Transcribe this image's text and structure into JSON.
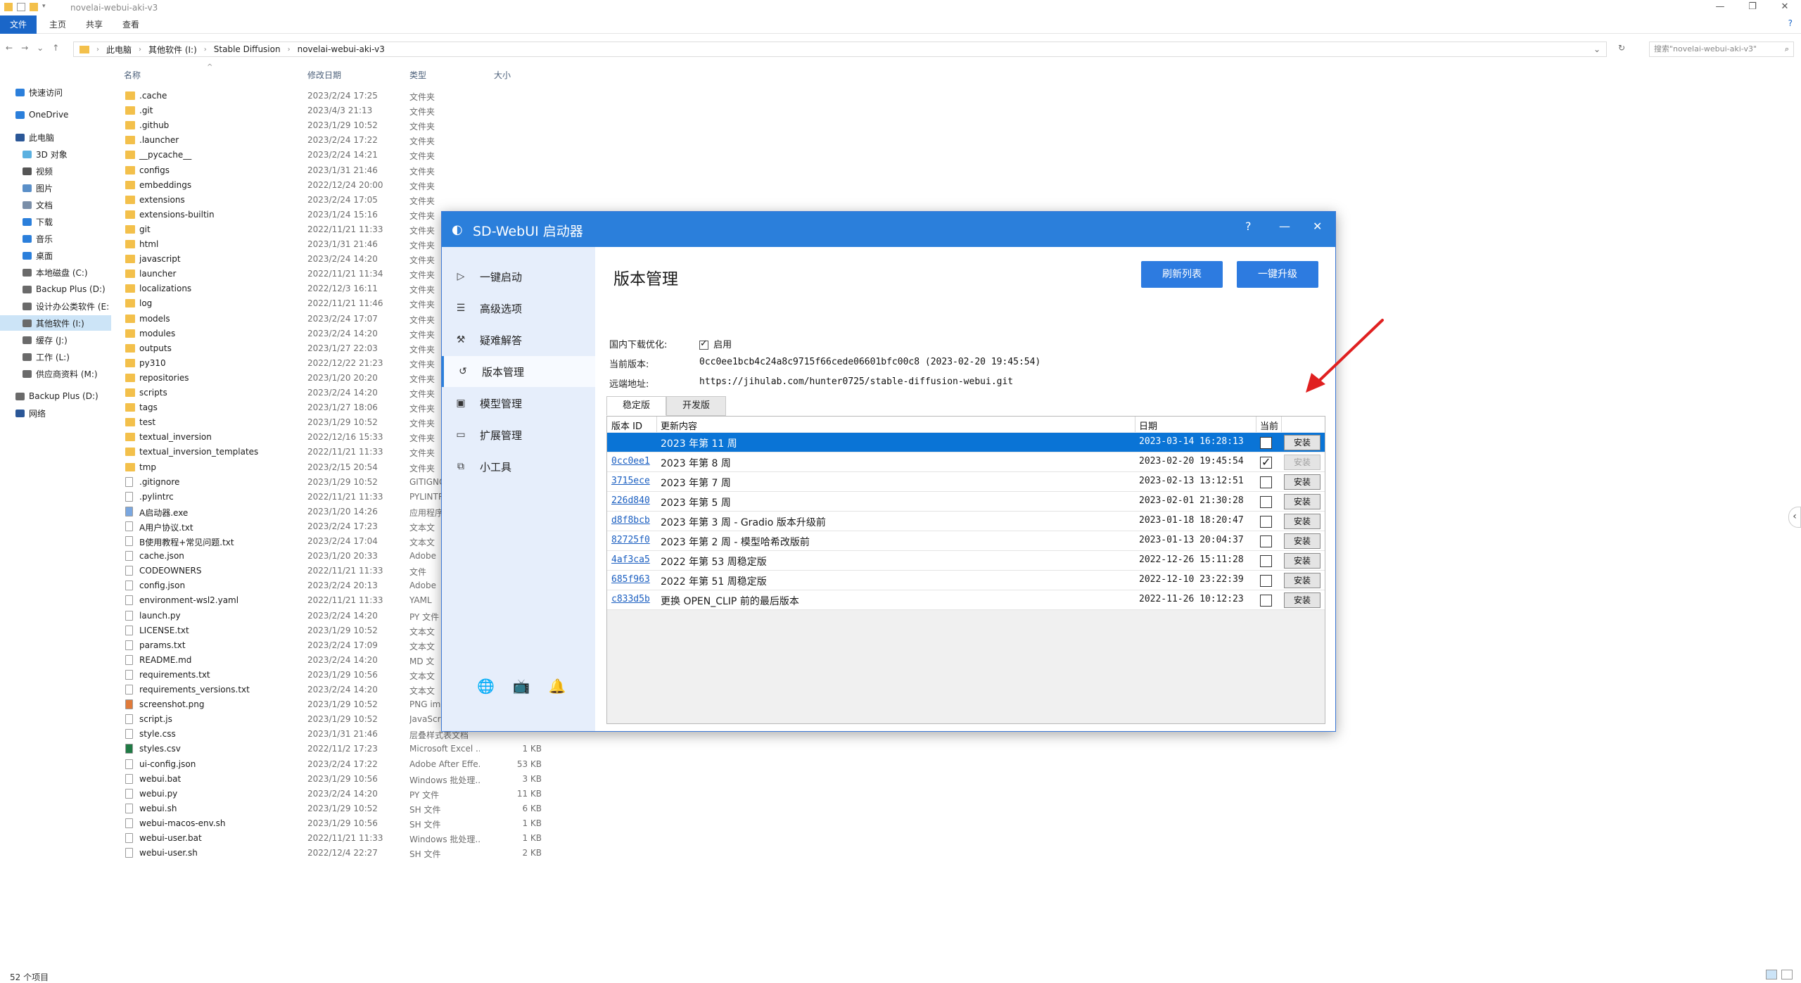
{
  "explorer": {
    "window_title": "novelai-webui-aki-v3",
    "ribbon_tabs": [
      "文件",
      "主页",
      "共享",
      "查看"
    ],
    "path": [
      "此电脑",
      "其他软件 (I:)",
      "Stable Diffusion",
      "novelai-webui-aki-v3"
    ],
    "search_placeholder": "搜索\"novelai-webui-aki-v3\"",
    "columns": {
      "name": "名称",
      "date": "修改日期",
      "type": "类型",
      "size": "大小"
    },
    "nav": [
      {
        "label": "快速访问",
        "icon": "star-icon",
        "color": "#2b7fdb"
      },
      {
        "label": "OneDrive",
        "icon": "cloud-icon",
        "color": "#2b7fdb"
      },
      {
        "label": "此电脑",
        "icon": "pc-icon",
        "color": "#2b5797"
      },
      {
        "label": "3D 对象",
        "icon": "cube-icon",
        "color": "#5ab0e0"
      },
      {
        "label": "视频",
        "icon": "video-icon",
        "color": "#555555"
      },
      {
        "label": "图片",
        "icon": "picture-icon",
        "color": "#5a8fc8"
      },
      {
        "label": "文档",
        "icon": "document-icon",
        "color": "#7a8ea8"
      },
      {
        "label": "下载",
        "icon": "download-icon",
        "color": "#2b7fdb"
      },
      {
        "label": "音乐",
        "icon": "music-icon",
        "color": "#2b7fdb"
      },
      {
        "label": "桌面",
        "icon": "desktop-icon",
        "color": "#2b7fdb"
      },
      {
        "label": "本地磁盘 (C:)",
        "icon": "drive-icon",
        "color": "#6a6a6a"
      },
      {
        "label": "Backup Plus (D:)",
        "icon": "drive-icon",
        "color": "#6a6a6a"
      },
      {
        "label": "设计办公类软件 (E:",
        "icon": "drive-icon",
        "color": "#6a6a6a"
      },
      {
        "label": "其他软件 (I:)",
        "icon": "drive-icon",
        "color": "#6a6a6a"
      },
      {
        "label": "缓存 (J:)",
        "icon": "drive-icon",
        "color": "#6a6a6a"
      },
      {
        "label": "工作 (L:)",
        "icon": "drive-icon",
        "color": "#6a6a6a"
      },
      {
        "label": "供应商资料 (M:)",
        "icon": "drive-icon",
        "color": "#6a6a6a"
      },
      {
        "label": "Backup Plus (D:)",
        "icon": "drive-icon",
        "color": "#6a6a6a"
      },
      {
        "label": "网络",
        "icon": "network-icon",
        "color": "#2b5797"
      }
    ],
    "files": [
      {
        "name": ".cache",
        "date": "2023/2/24 17:25",
        "type": "文件夹",
        "size": "",
        "kind": "folder"
      },
      {
        "name": ".git",
        "date": "2023/4/3 21:13",
        "type": "文件夹",
        "size": "",
        "kind": "folder"
      },
      {
        "name": ".github",
        "date": "2023/1/29 10:52",
        "type": "文件夹",
        "size": "",
        "kind": "folder"
      },
      {
        "name": ".launcher",
        "date": "2023/2/24 17:22",
        "type": "文件夹",
        "size": "",
        "kind": "folder"
      },
      {
        "name": "__pycache__",
        "date": "2023/2/24 14:21",
        "type": "文件夹",
        "size": "",
        "kind": "folder"
      },
      {
        "name": "configs",
        "date": "2023/1/31 21:46",
        "type": "文件夹",
        "size": "",
        "kind": "folder"
      },
      {
        "name": "embeddings",
        "date": "2022/12/24 20:00",
        "type": "文件夹",
        "size": "",
        "kind": "folder"
      },
      {
        "name": "extensions",
        "date": "2023/2/24 17:05",
        "type": "文件夹",
        "size": "",
        "kind": "folder"
      },
      {
        "name": "extensions-builtin",
        "date": "2023/1/24 15:16",
        "type": "文件夹",
        "size": "",
        "kind": "folder"
      },
      {
        "name": "git",
        "date": "2022/11/21 11:33",
        "type": "文件夹",
        "size": "",
        "kind": "folder"
      },
      {
        "name": "html",
        "date": "2023/1/31 21:46",
        "type": "文件夹",
        "size": "",
        "kind": "folder"
      },
      {
        "name": "javascript",
        "date": "2023/2/24 14:20",
        "type": "文件夹",
        "size": "",
        "kind": "folder"
      },
      {
        "name": "launcher",
        "date": "2022/11/21 11:34",
        "type": "文件夹",
        "size": "",
        "kind": "folder"
      },
      {
        "name": "localizations",
        "date": "2022/12/3 16:11",
        "type": "文件夹",
        "size": "",
        "kind": "folder"
      },
      {
        "name": "log",
        "date": "2022/11/21 11:46",
        "type": "文件夹",
        "size": "",
        "kind": "folder"
      },
      {
        "name": "models",
        "date": "2023/2/24 17:07",
        "type": "文件夹",
        "size": "",
        "kind": "folder"
      },
      {
        "name": "modules",
        "date": "2023/2/24 14:20",
        "type": "文件夹",
        "size": "",
        "kind": "folder"
      },
      {
        "name": "outputs",
        "date": "2023/1/27 22:03",
        "type": "文件夹",
        "size": "",
        "kind": "folder"
      },
      {
        "name": "py310",
        "date": "2022/12/22 21:23",
        "type": "文件夹",
        "size": "",
        "kind": "folder"
      },
      {
        "name": "repositories",
        "date": "2023/1/20 20:20",
        "type": "文件夹",
        "size": "",
        "kind": "folder"
      },
      {
        "name": "scripts",
        "date": "2023/2/24 14:20",
        "type": "文件夹",
        "size": "",
        "kind": "folder"
      },
      {
        "name": "tags",
        "date": "2023/1/27 18:06",
        "type": "文件夹",
        "size": "",
        "kind": "folder"
      },
      {
        "name": "test",
        "date": "2023/1/29 10:52",
        "type": "文件夹",
        "size": "",
        "kind": "folder"
      },
      {
        "name": "textual_inversion",
        "date": "2022/12/16 15:33",
        "type": "文件夹",
        "size": "",
        "kind": "folder"
      },
      {
        "name": "textual_inversion_templates",
        "date": "2022/11/21 11:33",
        "type": "文件夹",
        "size": "",
        "kind": "folder"
      },
      {
        "name": "tmp",
        "date": "2023/2/15 20:54",
        "type": "文件夹",
        "size": "",
        "kind": "folder"
      },
      {
        "name": ".gitignore",
        "date": "2023/1/29 10:52",
        "type": "GITIGNO",
        "size": "",
        "kind": "file"
      },
      {
        "name": ".pylintrc",
        "date": "2022/11/21 11:33",
        "type": "PYLINTR",
        "size": "",
        "kind": "file"
      },
      {
        "name": "A启动器.exe",
        "date": "2023/1/20 14:26",
        "type": "应用程序",
        "size": "",
        "kind": "exe"
      },
      {
        "name": "A用户协议.txt",
        "date": "2023/2/24 17:23",
        "type": "文本文",
        "size": "",
        "kind": "file"
      },
      {
        "name": "B使用教程+常见问题.txt",
        "date": "2023/2/24 17:04",
        "type": "文本文",
        "size": "",
        "kind": "file"
      },
      {
        "name": "cache.json",
        "date": "2023/1/20 20:33",
        "type": "Adobe",
        "size": "",
        "kind": "file"
      },
      {
        "name": "CODEOWNERS",
        "date": "2022/11/21 11:33",
        "type": "文件",
        "size": "",
        "kind": "file"
      },
      {
        "name": "config.json",
        "date": "2023/2/24 20:13",
        "type": "Adobe",
        "size": "",
        "kind": "file"
      },
      {
        "name": "environment-wsl2.yaml",
        "date": "2022/11/21 11:33",
        "type": "YAML",
        "size": "",
        "kind": "file"
      },
      {
        "name": "launch.py",
        "date": "2023/2/24 14:20",
        "type": "PY 文件",
        "size": "",
        "kind": "file"
      },
      {
        "name": "LICENSE.txt",
        "date": "2023/1/29 10:52",
        "type": "文本文",
        "size": "",
        "kind": "file"
      },
      {
        "name": "params.txt",
        "date": "2023/2/24 17:09",
        "type": "文本文",
        "size": "",
        "kind": "file"
      },
      {
        "name": "README.md",
        "date": "2023/2/24 14:20",
        "type": "MD 文",
        "size": "",
        "kind": "file"
      },
      {
        "name": "requirements.txt",
        "date": "2023/1/29 10:56",
        "type": "文本文",
        "size": "",
        "kind": "file"
      },
      {
        "name": "requirements_versions.txt",
        "date": "2023/2/24 14:20",
        "type": "文本文",
        "size": "",
        "kind": "file"
      },
      {
        "name": "screenshot.png",
        "date": "2023/1/29 10:52",
        "type": "PNG ima",
        "size": "",
        "kind": "image"
      },
      {
        "name": "script.js",
        "date": "2023/1/29 10:52",
        "type": "JavaScri",
        "size": "",
        "kind": "file"
      },
      {
        "name": "style.css",
        "date": "2023/1/31 21:46",
        "type": "层叠样式表文档",
        "size": "",
        "kind": "file"
      },
      {
        "name": "styles.csv",
        "date": "2022/11/2 17:23",
        "type": "Microsoft Excel ...",
        "size": "1 KB",
        "kind": "excel"
      },
      {
        "name": "ui-config.json",
        "date": "2023/2/24 17:22",
        "type": "Adobe After Effe...",
        "size": "53 KB",
        "kind": "file"
      },
      {
        "name": "webui.bat",
        "date": "2023/1/29 10:56",
        "type": "Windows 批处理...",
        "size": "3 KB",
        "kind": "file"
      },
      {
        "name": "webui.py",
        "date": "2023/2/24 14:20",
        "type": "PY 文件",
        "size": "11 KB",
        "kind": "file"
      },
      {
        "name": "webui.sh",
        "date": "2023/1/29 10:52",
        "type": "SH 文件",
        "size": "6 KB",
        "kind": "file"
      },
      {
        "name": "webui-macos-env.sh",
        "date": "2023/1/29 10:56",
        "type": "SH 文件",
        "size": "1 KB",
        "kind": "file"
      },
      {
        "name": "webui-user.bat",
        "date": "2022/11/21 11:33",
        "type": "Windows 批处理...",
        "size": "1 KB",
        "kind": "file"
      },
      {
        "name": "webui-user.sh",
        "date": "2022/12/4 22:27",
        "type": "SH 文件",
        "size": "2 KB",
        "kind": "file"
      }
    ],
    "status": "52 个项目"
  },
  "launcher": {
    "title": "SD-WebUI 启动器",
    "help": "?",
    "minimize": "—",
    "close": "✕",
    "sidebar": [
      {
        "label": "一键启动",
        "icon": "play-icon",
        "glyph": "▷"
      },
      {
        "label": "高级选项",
        "icon": "list-icon",
        "glyph": "☰"
      },
      {
        "label": "疑难解答",
        "icon": "wrench-icon",
        "glyph": "⚒"
      },
      {
        "label": "版本管理",
        "icon": "history-icon",
        "glyph": "↺"
      },
      {
        "label": "模型管理",
        "icon": "model-icon",
        "glyph": "▣"
      },
      {
        "label": "扩展管理",
        "icon": "extension-icon",
        "glyph": "▭"
      },
      {
        "label": "小工具",
        "icon": "tools-icon",
        "glyph": "⧉"
      }
    ],
    "bottom_icons": [
      {
        "name": "globe-icon",
        "glyph": "🌐"
      },
      {
        "name": "bilibili-icon",
        "glyph": "📺"
      },
      {
        "name": "qq-icon",
        "glyph": "🔔"
      }
    ],
    "page_title": "版本管理",
    "refresh_button": "刷新列表",
    "upgrade_button": "一键升级",
    "download_opt_label": "国内下载优化:",
    "download_opt_value": "启用",
    "current_version_label": "当前版本:",
    "current_version_value": "0cc0ee1bcb4c24a8c9715f66cede06601bfc00c8 (2023-02-20 19:45:54)",
    "remote_label": "远端地址:",
    "remote_value": "https://jihulab.com/hunter0725/stable-diffusion-webui.git",
    "tabs": [
      "稳定版",
      "开发版"
    ],
    "table_headers": {
      "id": "版本 ID",
      "desc": "更新内容",
      "date": "日期",
      "current": "当前"
    },
    "versions": [
      {
        "id": "",
        "desc": "2023 年第 11 周",
        "date": "2023-03-14 16:28:13",
        "current": false,
        "action": "安装",
        "selected": true
      },
      {
        "id": "0cc0ee1",
        "desc": "2023 年第 8 周",
        "date": "2023-02-20 19:45:54",
        "current": true,
        "action": "安装",
        "selected": false
      },
      {
        "id": "3715ece",
        "desc": "2023 年第 7 周",
        "date": "2023-02-13 13:12:51",
        "current": false,
        "action": "安装",
        "selected": false
      },
      {
        "id": "226d840",
        "desc": "2023 年第 5 周",
        "date": "2023-02-01 21:30:28",
        "current": false,
        "action": "安装",
        "selected": false
      },
      {
        "id": "d8f8bcb",
        "desc": "2023 年第 3 周 - Gradio 版本升级前",
        "date": "2023-01-18 18:20:47",
        "current": false,
        "action": "安装",
        "selected": false
      },
      {
        "id": "82725f0",
        "desc": "2023 年第 2 周 - 模型哈希改版前",
        "date": "2023-01-13 20:04:37",
        "current": false,
        "action": "安装",
        "selected": false
      },
      {
        "id": "4af3ca5",
        "desc": "2022 年第 53 周稳定版",
        "date": "2022-12-26 15:11:28",
        "current": false,
        "action": "安装",
        "selected": false
      },
      {
        "id": "685f963",
        "desc": "2022 年第 51 周稳定版",
        "date": "2022-12-10 23:22:39",
        "current": false,
        "action": "安装",
        "selected": false
      },
      {
        "id": "c833d5b",
        "desc": "更换 OPEN_CLIP 前的最后版本",
        "date": "2022-11-26 10:12:23",
        "current": false,
        "action": "安装",
        "selected": false
      }
    ]
  },
  "colors": {
    "accent": "#2b7fdb",
    "selected_row": "#0a74d6",
    "annotation_arrow": "#e02020"
  }
}
